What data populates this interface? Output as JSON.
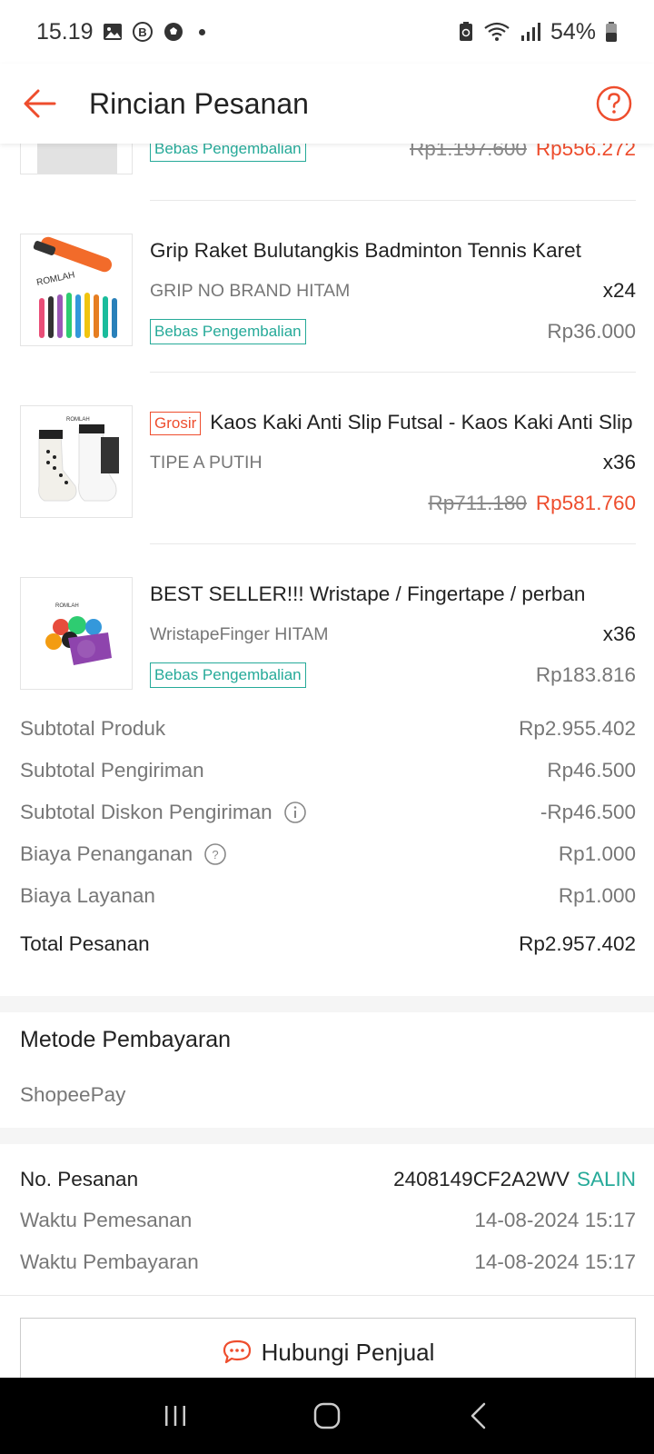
{
  "status_bar": {
    "time": "15.19",
    "battery": "54%"
  },
  "header": {
    "title": "Rincian Pesanan"
  },
  "products": [
    {
      "name": "",
      "variant": "",
      "qty": "",
      "badge": "Bebas Pengembalian",
      "price_old": "Rp1.197.600",
      "price_new": "Rp556.272"
    },
    {
      "name": "Grip Raket Bulutangkis Badminton Tennis Karet",
      "variant": "GRIP NO BRAND HITAM",
      "qty": "x24",
      "badge": "Bebas Pengembalian",
      "price": "Rp36.000",
      "thumb_text": "ROMLAH"
    },
    {
      "tag": "Grosir",
      "name": "Kaos Kaki Anti Slip Futsal - Kaos Kaki Anti Slip",
      "variant": "TIPE A PUTIH",
      "qty": "x36",
      "price_old": "Rp711.180",
      "price_new": "Rp581.760",
      "thumb_text": "ROMLAH"
    },
    {
      "name": "BEST SELLER!!! Wristape / Fingertape / perban",
      "variant": "WristapeFinger HITAM",
      "qty": "x36",
      "badge": "Bebas Pengembalian",
      "price": "Rp183.816",
      "thumb_text": "ROMLAH"
    }
  ],
  "summary": {
    "subtotal_produk_label": "Subtotal Produk",
    "subtotal_produk": "Rp2.955.402",
    "subtotal_pengiriman_label": "Subtotal Pengiriman",
    "subtotal_pengiriman": "Rp46.500",
    "diskon_pengiriman_label": "Subtotal Diskon Pengiriman",
    "diskon_pengiriman": "-Rp46.500",
    "biaya_penanganan_label": "Biaya Penanganan",
    "biaya_penanganan": "Rp1.000",
    "biaya_layanan_label": "Biaya Layanan",
    "biaya_layanan": "Rp1.000",
    "total_label": "Total Pesanan",
    "total": "Rp2.957.402"
  },
  "payment": {
    "title": "Metode Pembayaran",
    "method": "ShopeePay"
  },
  "order": {
    "no_label": "No. Pesanan",
    "no_value": "2408149CF2A2WV",
    "copy_label": "SALIN",
    "waktu_pemesanan_label": "Waktu Pemesanan",
    "waktu_pemesanan": "14-08-2024 15:17",
    "waktu_pembayaran_label": "Waktu Pembayaran",
    "waktu_pembayaran": "14-08-2024 15:17"
  },
  "contact_button": "Hubungi Penjual",
  "colors": {
    "accent": "#ee4d2d",
    "teal": "#26aa99"
  }
}
